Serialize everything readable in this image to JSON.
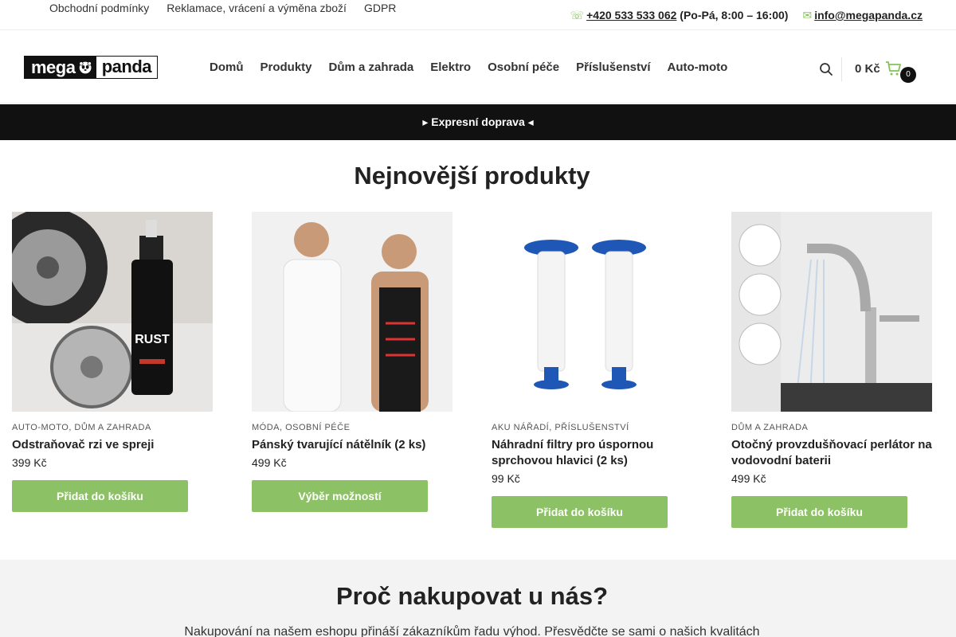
{
  "topbar": {
    "links": [
      "Obchodní podmínky",
      "Reklamace, vrácení a výměna zboží",
      "GDPR"
    ],
    "phone": "+420 533 533 062",
    "hours": "(Po-Pá, 8:00 – 16:00)",
    "email": "info@megapanda.cz"
  },
  "header": {
    "logo_left": "mega",
    "logo_right": "panda",
    "nav": [
      "Domů",
      "Produkty",
      "Dům a zahrada",
      "Elektro",
      "Osobní péče",
      "Příslušenství",
      "Auto-moto"
    ],
    "cart_total": "0 Kč",
    "cart_count": "0"
  },
  "banner": {
    "text": "Expresní doprava"
  },
  "newest": {
    "heading": "Nejnovější produkty",
    "products": [
      {
        "category": "AUTO-MOTO, DŮM A ZAHRADA",
        "title": "Odstraňovač rzi ve spreji",
        "price": "399 Kč",
        "button": "Přidat do košíku",
        "label": "RUST"
      },
      {
        "category": "MÓDA, OSOBNÍ PÉČE",
        "title": "Pánský tvarující nátělník (2 ks)",
        "price": "499 Kč",
        "button": "Výběr možností"
      },
      {
        "category": "AKU NÁŘADÍ, PŘÍSLUŠENSTVÍ",
        "title": "Náhradní filtry pro úspornou sprchovou hlavici (2 ks)",
        "price": "99 Kč",
        "button": "Přidat do košíku"
      },
      {
        "category": "DŮM A ZAHRADA",
        "title": "Otočný provzdušňovací perlátor na vodovodní baterii",
        "price": "499 Kč",
        "button": "Přidat do košíku"
      }
    ]
  },
  "why": {
    "heading": "Proč nakupovat u nás?",
    "text": "Nakupování na našem eshopu přináší zákazníkům řadu výhod. Přesvědčte se sami o našich kvalitách"
  },
  "colors": {
    "accent": "#8cc265",
    "dark": "#111111"
  }
}
